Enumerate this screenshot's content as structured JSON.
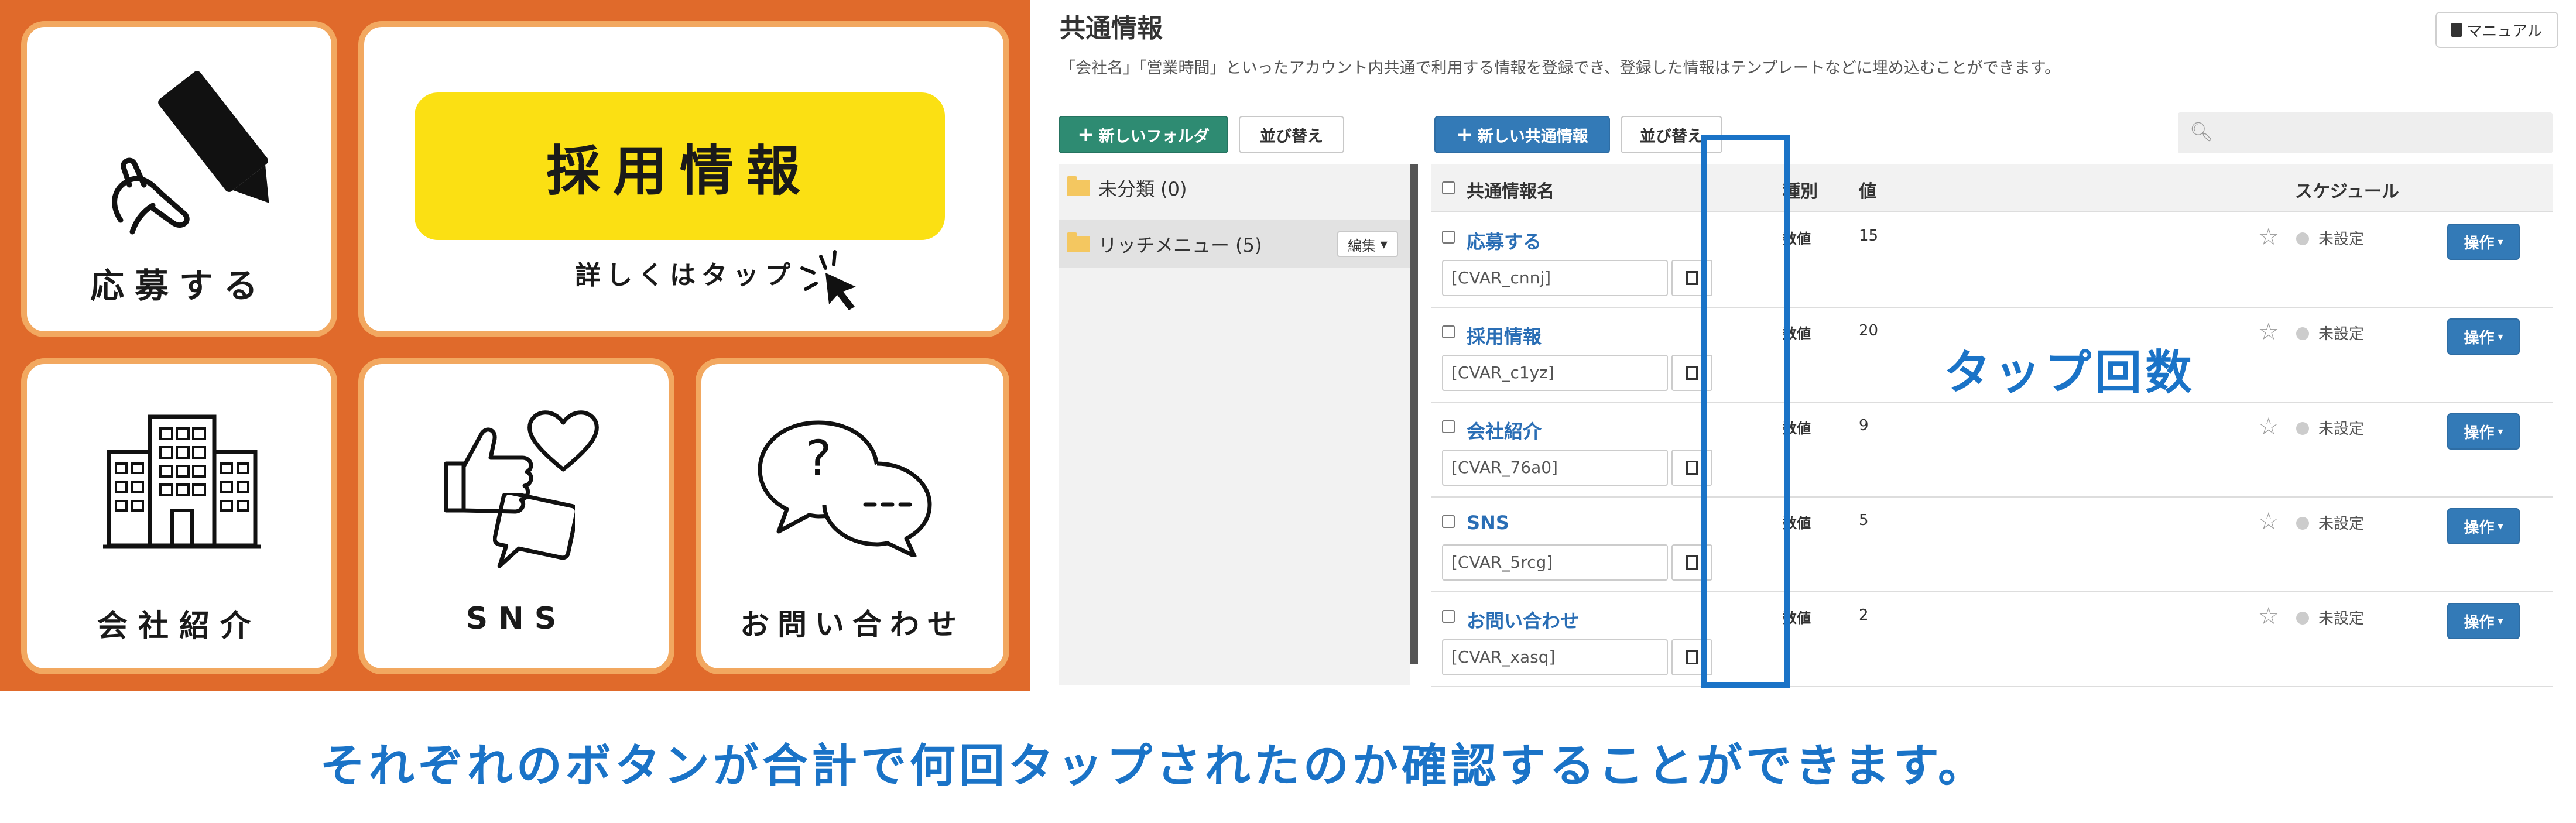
{
  "rich_menu": {
    "apply_label": "応募する",
    "recruit_label": "採用情報",
    "recruit_note": "詳しくはタップ",
    "company_label": "会社紹介",
    "sns_label": "SNS",
    "inquiry_label": "お問い合わせ",
    "inquiry_bubble_q": "?",
    "colors": {
      "background": "#e06a2b",
      "tile_border": "#f2a860",
      "yellow": "#fbe013"
    }
  },
  "admin": {
    "title": "共通情報",
    "description": "「会社名」「営業時間」といったアカウント内共通で利用する情報を登録でき、登録した情報はテンプレートなどに埋め込むことができます。",
    "manual_label": "マニュアル",
    "new_folder_label": "新しいフォルダ",
    "sort_label": "並び替え",
    "new_item_label": "新しい共通情報",
    "sort_label_2": "並び替え",
    "folders": [
      {
        "label": "未分類 (0)"
      },
      {
        "label": "リッチメニュー (5)",
        "edit": "編集"
      }
    ],
    "columns": {
      "name": "共通情報名",
      "type": "種別",
      "value": "値",
      "schedule": "スケジュール"
    },
    "rows": [
      {
        "name": "応募する",
        "var": "[CVAR_cnnj]",
        "type": "数値",
        "value": "15",
        "schedule": "未設定",
        "op": "操作"
      },
      {
        "name": "採用情報",
        "var": "[CVAR_c1yz]",
        "type": "数値",
        "value": "20",
        "schedule": "未設定",
        "op": "操作"
      },
      {
        "name": "会社紹介",
        "var": "[CVAR_76a0]",
        "type": "数値",
        "value": "9",
        "schedule": "未設定",
        "op": "操作"
      },
      {
        "name": "SNS",
        "var": "[CVAR_5rcg]",
        "type": "数値",
        "value": "5",
        "schedule": "未設定",
        "op": "操作"
      },
      {
        "name": "お問い合わせ",
        "var": "[CVAR_xasq]",
        "type": "数値",
        "value": "2",
        "schedule": "未設定",
        "op": "操作"
      }
    ]
  },
  "annotation": {
    "tap_count": "タップ回数",
    "accent": "#1a73c7"
  },
  "caption": "それぞれのボタンが合計で何回タップされたのか確認することができます。"
}
